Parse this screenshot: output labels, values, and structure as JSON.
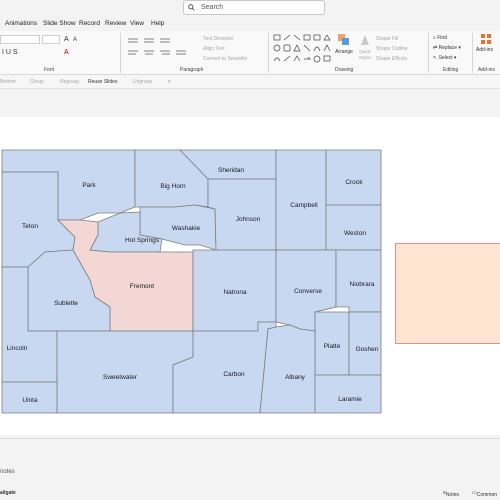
{
  "search": {
    "placeholder": "Search"
  },
  "menu": [
    "Animations",
    "Slide Show",
    "Record",
    "Review",
    "View",
    "Help"
  ],
  "ribbon": {
    "groups": {
      "font": "Font",
      "paragraph": "Paragraph",
      "drawing": "Drawing",
      "editing": "Editing",
      "addins": "Add-ins"
    },
    "font_size_labels": [
      "A",
      "A"
    ],
    "paragraph_items": [
      "Text Direction",
      "Align Text",
      "Convert to SmartArt"
    ],
    "drawing_buttons": {
      "arrange": "Arrange",
      "quick_styles": "Quick Styles"
    },
    "shape_items": [
      "Shape Fill",
      "Shape Outline",
      "Shape Effects"
    ],
    "editing_items": [
      "Find",
      "Replace",
      "Select"
    ],
    "addins_label": "Add-ins"
  },
  "subbar": {
    "items": [
      "Bottom",
      "Group",
      "Regroup",
      "Reuse Slides",
      "Ungroup"
    ],
    "active": "Reuse Slides"
  },
  "map": {
    "counties": [
      "Park",
      "Big Horn",
      "Sheridan",
      "Crook",
      "Teton",
      "Washakie",
      "Johnson",
      "Campbell",
      "Hot Springs",
      "Weston",
      "Fremont",
      "Natrona",
      "Converse",
      "Niobrara",
      "Sublette",
      "Lincoln",
      "Platte",
      "Goshen",
      "Sweetwater",
      "Carbon",
      "Albany",
      "Uinta",
      "Laramie"
    ],
    "highlighted": "Fremont",
    "fill": "#c7d8f0",
    "highlight_fill": "#f2d7d4",
    "border": "#7d7d7d",
    "box_fill": "#fde5d2",
    "box_border": "#e58e8e"
  },
  "notes": {
    "label": "notes"
  },
  "status": {
    "left": "ailgate",
    "notes": "Notes",
    "comments": "Commen"
  }
}
